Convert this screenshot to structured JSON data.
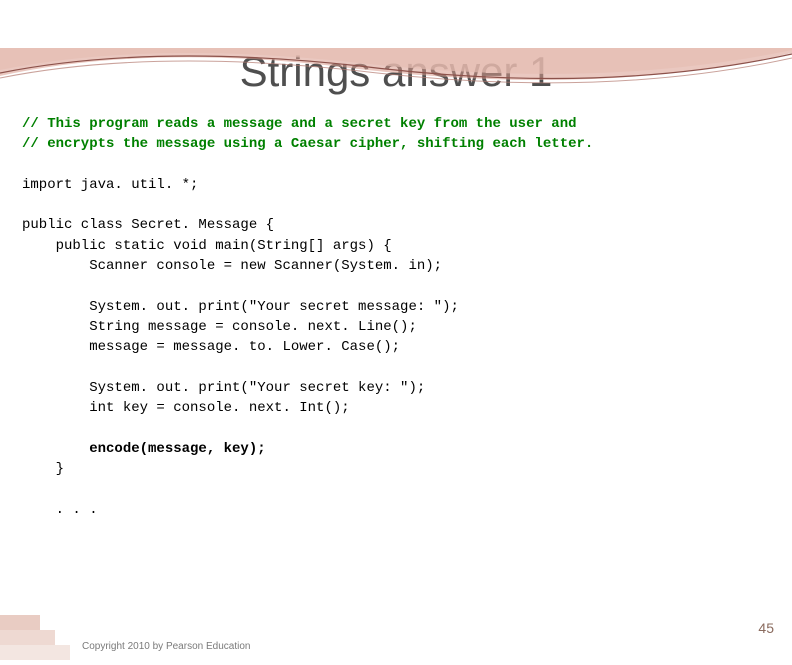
{
  "title": "Strings answer 1",
  "code": {
    "comment1": "// This program reads a message and a secret key from the user and",
    "comment2": "// encrypts the message using a Caesar cipher, shifting each letter.",
    "line_import": "import java. util. *;",
    "line_class": "public class Secret. Message {",
    "line_main": "    public static void main(String[] args) {",
    "line_scanner": "        Scanner console = new Scanner(System. in);",
    "line_p1": "        System. out. print(\"Your secret message: \");",
    "line_msg": "        String message = console. next. Line();",
    "line_lower": "        message = message. to. Lower. Case();",
    "line_p2": "        System. out. print(\"Your secret key: \");",
    "line_key": "        int key = console. next. Int();",
    "line_encode": "        encode(message, key);",
    "line_close": "    }",
    "line_dots": "    . . ."
  },
  "copyright": "Copyright 2010 by Pearson Education",
  "pagenum": "45"
}
